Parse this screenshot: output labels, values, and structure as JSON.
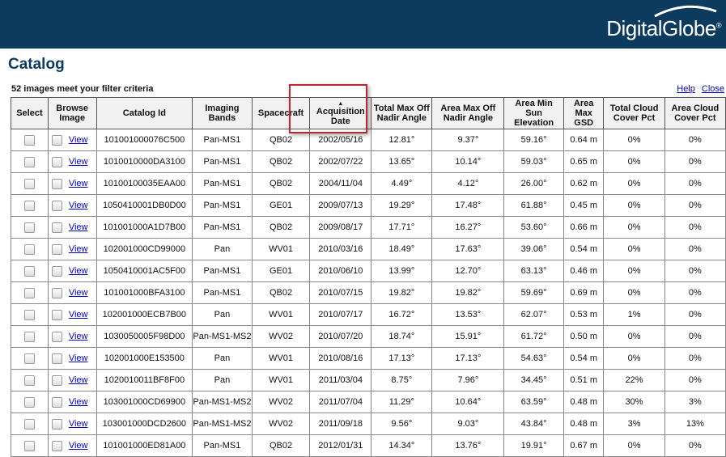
{
  "header": {
    "logo_text": "DigitalGlobe",
    "trademark": "®",
    "bg_color": "#0c3b5e"
  },
  "page_title": "Catalog",
  "filter_summary": "52 images meet your filter criteria",
  "links": {
    "help": "Help",
    "close": "Close"
  },
  "table": {
    "columns": [
      "Select",
      "Browse Image",
      "Catalog Id",
      "Imaging Bands",
      "Spacecraft",
      "Acquisition Date",
      "Total Max Off Nadir Angle",
      "Area Max Off Nadir Angle",
      "Area Min Sun Elevation",
      "Area Max GSD",
      "Total Cloud Cover Pct",
      "Area Cloud Cover Pct"
    ],
    "sorted_column": "Acquisition Date",
    "sort_direction": "ascending",
    "view_label": "View",
    "rows": [
      [
        "101001000076C500",
        "Pan-MS1",
        "QB02",
        "2002/05/16",
        "12.81°",
        "9.37°",
        "59.16°",
        "0.64 m",
        "0%",
        "0%"
      ],
      [
        "1010010000DA3100",
        "Pan-MS1",
        "QB02",
        "2002/07/22",
        "13.65°",
        "10.14°",
        "59.03°",
        "0.65 m",
        "0%",
        "0%"
      ],
      [
        "10100100035EAA00",
        "Pan-MS1",
        "QB02",
        "2004/11/04",
        "4.49°",
        "4.12°",
        "26.00°",
        "0.62 m",
        "0%",
        "0%"
      ],
      [
        "1050410001DB0D00",
        "Pan-MS1",
        "GE01",
        "2009/07/13",
        "19.29°",
        "17.48°",
        "61.88°",
        "0.45 m",
        "0%",
        "0%"
      ],
      [
        "101001000A1D7B00",
        "Pan-MS1",
        "QB02",
        "2009/08/17",
        "17.71°",
        "16.27°",
        "53.60°",
        "0.66 m",
        "0%",
        "0%"
      ],
      [
        "102001000CD99000",
        "Pan",
        "WV01",
        "2010/03/16",
        "18.49°",
        "17.63°",
        "39.06°",
        "0.54 m",
        "0%",
        "0%"
      ],
      [
        "1050410001AC5F00",
        "Pan-MS1",
        "GE01",
        "2010/06/10",
        "13.99°",
        "12.70°",
        "63.13°",
        "0.46 m",
        "0%",
        "0%"
      ],
      [
        "101001000BFA3100",
        "Pan-MS1",
        "QB02",
        "2010/07/15",
        "19.82°",
        "19.82°",
        "59.69°",
        "0.69 m",
        "0%",
        "0%"
      ],
      [
        "102001000ECB7B00",
        "Pan",
        "WV01",
        "2010/07/17",
        "16.72°",
        "13.53°",
        "62.07°",
        "0.53 m",
        "1%",
        "0%"
      ],
      [
        "1030050005F98D00",
        "Pan-MS1-MS2",
        "WV02",
        "2010/07/20",
        "18.74°",
        "15.91°",
        "61.72°",
        "0.50 m",
        "0%",
        "0%"
      ],
      [
        "102001000E153500",
        "Pan",
        "WV01",
        "2010/08/16",
        "17.13°",
        "17.13°",
        "54.63°",
        "0.54 m",
        "0%",
        "0%"
      ],
      [
        "102001001 1BF8F00",
        "Pan",
        "WV01",
        "2011/03/04",
        "8.75°",
        "7.96°",
        "34.45°",
        "0.51 m",
        "22%",
        "0%"
      ],
      [
        "103001000CD69900",
        "Pan-MS1-MS2",
        "WV02",
        "2011/07/04",
        "11.29°",
        "10.64°",
        "63.59°",
        "0.48 m",
        "30%",
        "3%"
      ],
      [
        "103001000DCD2600",
        "Pan-MS1-MS2",
        "WV02",
        "2011/09/18",
        "9.56°",
        "9.03°",
        "43.84°",
        "0.48 m",
        "3%",
        "13%"
      ],
      [
        "101001000ED81A00",
        "Pan-MS1",
        "QB02",
        "2012/01/31",
        "14.34°",
        "13.76°",
        "19.91°",
        "0.67 m",
        "0%",
        "0%"
      ]
    ]
  }
}
